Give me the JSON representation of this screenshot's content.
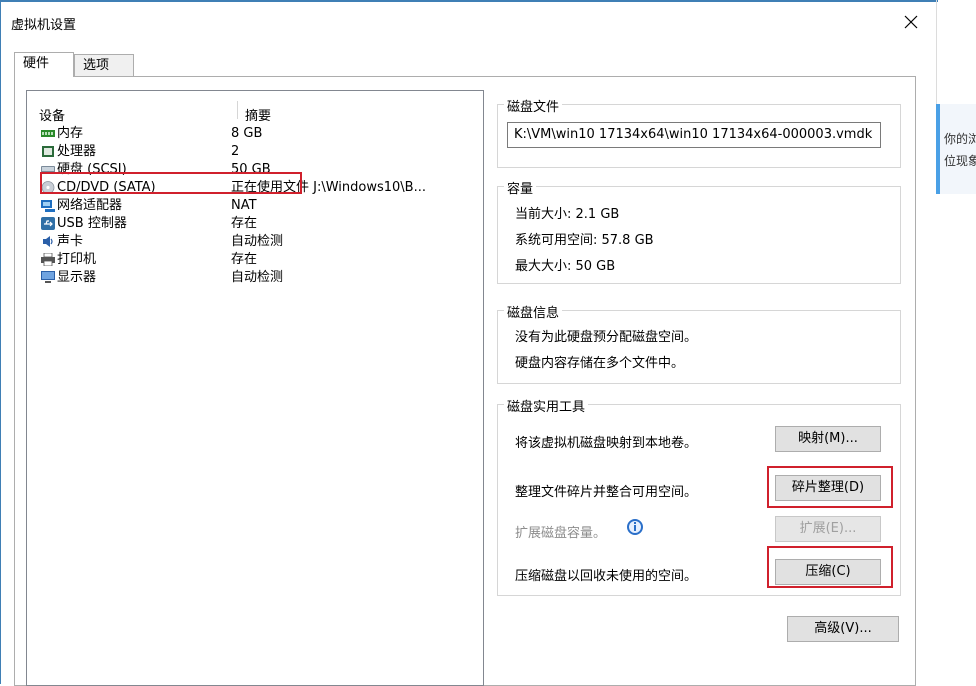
{
  "window": {
    "title": "虚拟机设置"
  },
  "tabs": [
    {
      "label": "硬件"
    },
    {
      "label": "选项"
    }
  ],
  "device_list": {
    "columns": [
      "设备",
      "摘要"
    ],
    "rows": [
      {
        "name": "内存",
        "summary": "8 GB",
        "icon": "memory-icon"
      },
      {
        "name": "处理器",
        "summary": "2",
        "icon": "processor-icon"
      },
      {
        "name": "硬盘 (SCSI)",
        "summary": "50 GB",
        "icon": "harddisk-icon"
      },
      {
        "name": "CD/DVD (SATA)",
        "summary": "正在使用文件 J:\\Windows10\\B...",
        "icon": "cd-dvd-icon"
      },
      {
        "name": "网络适配器",
        "summary": "NAT",
        "icon": "network-adapter-icon"
      },
      {
        "name": "USB 控制器",
        "summary": "存在",
        "icon": "usb-icon"
      },
      {
        "name": "声卡",
        "summary": "自动检测",
        "icon": "sound-card-icon"
      },
      {
        "name": "打印机",
        "summary": "存在",
        "icon": "printer-icon"
      },
      {
        "name": "显示器",
        "summary": "自动检测",
        "icon": "display-icon"
      }
    ]
  },
  "disk_file": {
    "label": "磁盘文件",
    "path": "K:\\VM\\win10 17134x64\\win10 17134x64-000003.vmdk"
  },
  "capacity": {
    "label": "容量",
    "current": "当前大小: 2.1 GB",
    "available": "系统可用空间: 57.8 GB",
    "max": "最大大小: 50 GB"
  },
  "disk_info": {
    "label": "磁盘信息",
    "line1": "没有为此硬盘预分配磁盘空间。",
    "line2": "硬盘内容存储在多个文件中。"
  },
  "utilities": {
    "label": "磁盘实用工具",
    "map_text": "将该虚拟机磁盘映射到本地卷。",
    "map_button": "映射(M)...",
    "defrag_text": "整理文件碎片并整合可用空间。",
    "defrag_button": "碎片整理(D)",
    "expand_text": "扩展磁盘容量。",
    "expand_button": "扩展(E)...",
    "compact_text": "压缩磁盘以回收未使用的空间。",
    "compact_button": "压缩(C)"
  },
  "advanced_button": "高级(V)...",
  "side_note": {
    "line1": "你的浏览",
    "line2": "位现象，"
  }
}
